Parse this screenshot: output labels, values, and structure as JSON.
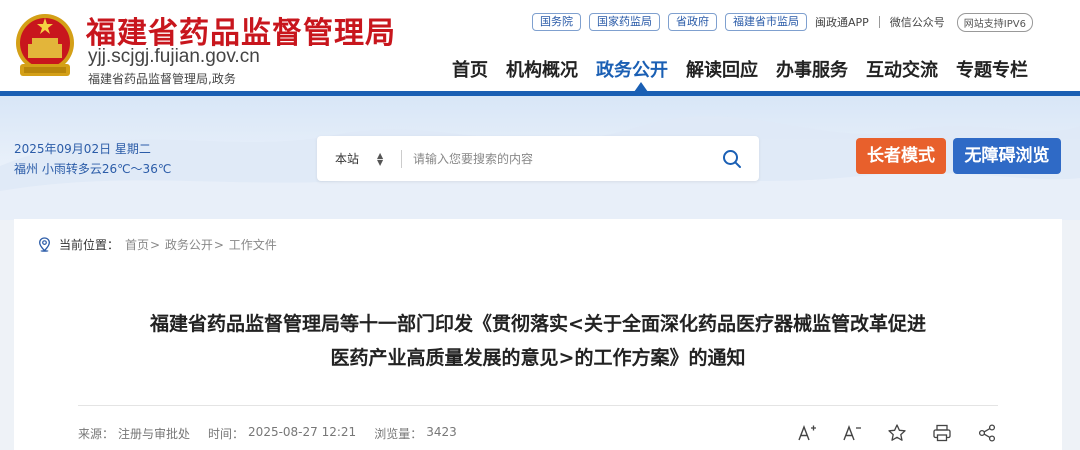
{
  "header": {
    "title": "福建省药品监督管理局",
    "domain": "yjj.scjgj.fujian.gov.cn",
    "subtitle": "福建省药品监督管理局,政务",
    "top_links": [
      "国务院",
      "国家药监局",
      "省政府",
      "福建省市监局"
    ],
    "app_label": "闽政通APP",
    "wechat_label": "微信公众号",
    "ipv6_label": "网站支持IPV6"
  },
  "nav": {
    "items": [
      "首页",
      "机构概况",
      "政务公开",
      "解读回应",
      "办事服务",
      "互动交流",
      "专题专栏"
    ],
    "active": "政务公开"
  },
  "banner": {
    "date": "2025年09月02日 星期二",
    "weather": "福州 小雨转多云26℃～36℃",
    "search_scope": "本站",
    "search_placeholder": "请输入您要搜索的内容",
    "elder_mode": "长者模式",
    "accessible": "无障碍浏览"
  },
  "breadcrumb": {
    "label": "当前位置：",
    "items": [
      "首页",
      "政务公开",
      "工作文件"
    ]
  },
  "article": {
    "title_line1": "福建省药品监督管理局等十一部门印发《贯彻落实<关于全面深化药品医疗器械监管改革促进",
    "title_line2": "医药产业高质量发展的意见>的工作方案》的通知",
    "source_label": "来源：",
    "source": "注册与审批处",
    "time_label": "时间：",
    "time": "2025-08-27 12:21",
    "views_label": "浏览量：",
    "views": "3423"
  },
  "colors": {
    "brand_red": "#c8161d",
    "brand_blue": "#1a5fb4",
    "elder_orange": "#e8602c",
    "access_blue": "#2f6ac6"
  },
  "icons": [
    "emblem-icon",
    "search-icon",
    "location-icon",
    "font-increase-icon",
    "font-decrease-icon",
    "star-icon",
    "print-icon",
    "share-icon"
  ]
}
